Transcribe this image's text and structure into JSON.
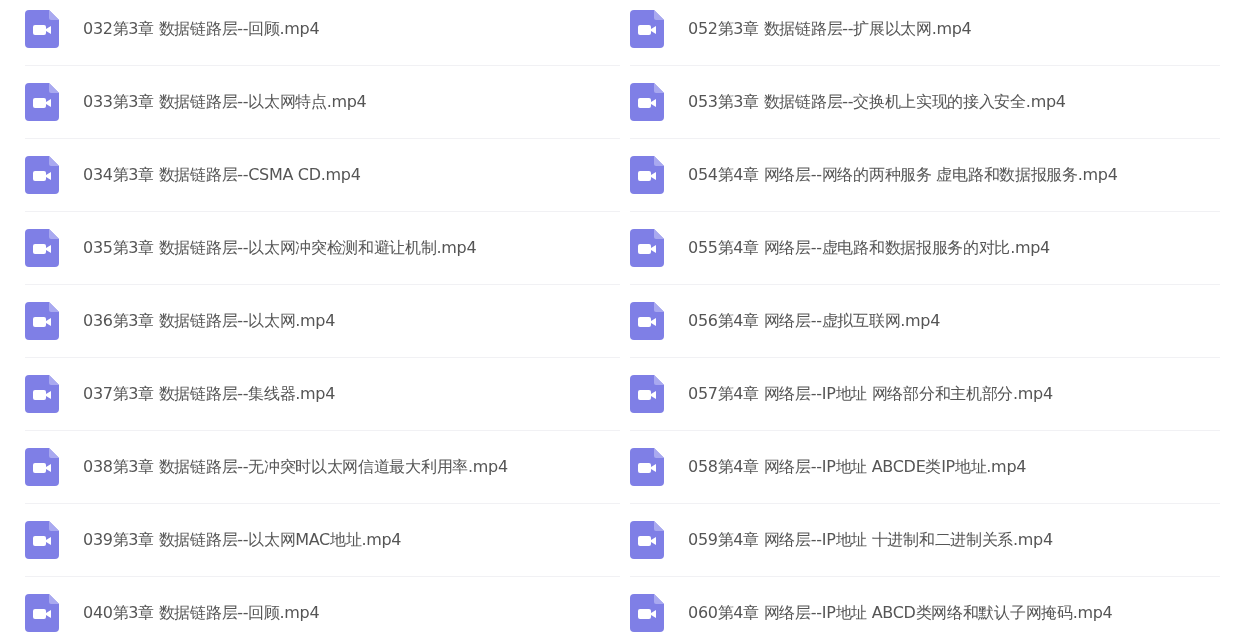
{
  "columns": [
    {
      "files": [
        {
          "name": "032第3章 数据链路层--回顾.mp4"
        },
        {
          "name": "033第3章 数据链路层--以太网特点.mp4"
        },
        {
          "name": "034第3章 数据链路层--CSMA CD.mp4"
        },
        {
          "name": "035第3章 数据链路层--以太网冲突检测和避让机制.mp4"
        },
        {
          "name": "036第3章 数据链路层--以太网.mp4"
        },
        {
          "name": "037第3章 数据链路层--集线器.mp4"
        },
        {
          "name": "038第3章 数据链路层--无冲突时以太网信道最大利用率.mp4"
        },
        {
          "name": "039第3章 数据链路层--以太网MAC地址.mp4"
        },
        {
          "name": "040第3章 数据链路层--回顾.mp4"
        }
      ]
    },
    {
      "files": [
        {
          "name": "052第3章 数据链路层--扩展以太网.mp4"
        },
        {
          "name": "053第3章 数据链路层--交换机上实现的接入安全.mp4"
        },
        {
          "name": "054第4章 网络层--网络的两种服务 虚电路和数据报服务.mp4"
        },
        {
          "name": "055第4章 网络层--虚电路和数据报服务的对比.mp4"
        },
        {
          "name": "056第4章 网络层--虚拟互联网.mp4"
        },
        {
          "name": "057第4章 网络层--IP地址 网络部分和主机部分.mp4"
        },
        {
          "name": "058第4章 网络层--IP地址 ABCDE类IP地址.mp4"
        },
        {
          "name": "059第4章 网络层--IP地址 十进制和二进制关系.mp4"
        },
        {
          "name": "060第4章 网络层--IP地址 ABCD类网络和默认子网掩码.mp4"
        }
      ]
    }
  ]
}
